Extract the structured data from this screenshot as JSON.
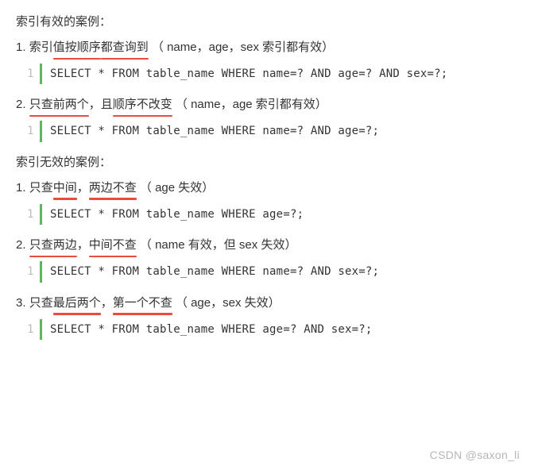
{
  "valid_title": "索引有效的案例：",
  "invalid_title": "索引无效的案例：",
  "valid": [
    {
      "num": "1.",
      "pre": "索引",
      "u1": "值按顺序",
      "mid": "",
      "u2": "都查询到",
      "paren": "（ name，age，sex 索引都有效）",
      "code": "SELECT * FROM table_name WHERE name=? AND age=? AND sex=?;"
    },
    {
      "num": "2.",
      "pre": "",
      "u1": "只查前两个",
      "mid": "，且",
      "u2": "顺序不改变",
      "paren": "（ name，age 索引都有效）",
      "code": "SELECT * FROM table_name WHERE name=? AND age=?;"
    }
  ],
  "invalid": [
    {
      "num": "1.",
      "pre": "只查",
      "u1": "中间",
      "mid": "，",
      "u2": "两边不查",
      "paren": "（ age 失效）",
      "code": "SELECT * FROM table_name WHERE age=?;"
    },
    {
      "num": "2.",
      "pre": "",
      "u1": "只查两边",
      "mid": "，",
      "u2": "中间不查",
      "paren": "（ name 有效，但 sex 失效）",
      "code": "SELECT * FROM table_name WHERE name=? AND sex=?;"
    },
    {
      "num": "3.",
      "pre": "只查",
      "u1": "最后两个",
      "mid": "，",
      "u2": "第一个不查",
      "paren": "（ age，sex 失效）",
      "code": "SELECT * FROM table_name WHERE age=? AND sex=?;"
    }
  ],
  "line_no": "1",
  "watermark": "CSDN @saxon_li"
}
